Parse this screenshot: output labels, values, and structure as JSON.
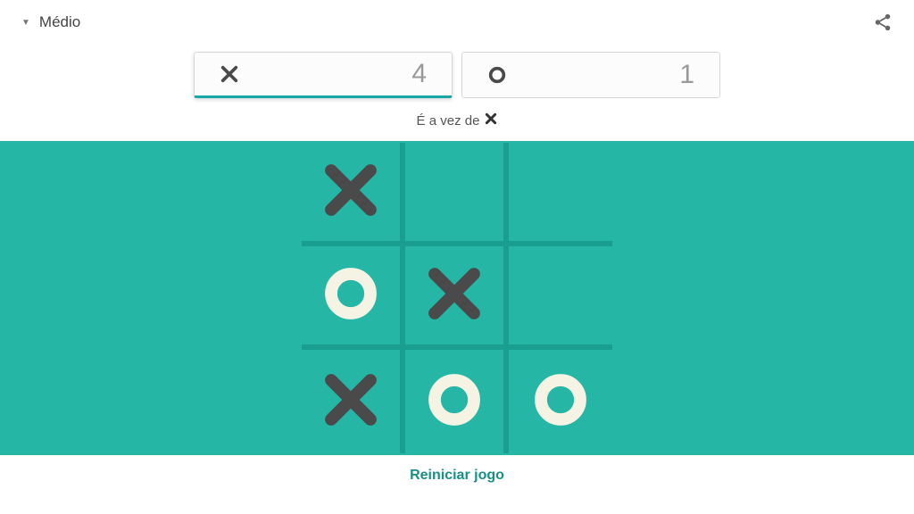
{
  "header": {
    "difficulty_label": "Médio"
  },
  "scores": {
    "x": {
      "symbol": "X",
      "value": "4",
      "active": true
    },
    "o": {
      "symbol": "O",
      "value": "1",
      "active": false
    }
  },
  "turn": {
    "prefix": "É a vez de",
    "player": "X"
  },
  "board": {
    "cells": [
      "X",
      "",
      "",
      "O",
      "X",
      "",
      "X",
      "O",
      "O"
    ]
  },
  "restart_label": "Reiniciar jogo",
  "colors": {
    "board_bg": "#26b6a6",
    "grid": "#1a9e90",
    "x": "#4a4a4a",
    "o": "#f4f3e4",
    "accent": "#1aa6a4"
  }
}
